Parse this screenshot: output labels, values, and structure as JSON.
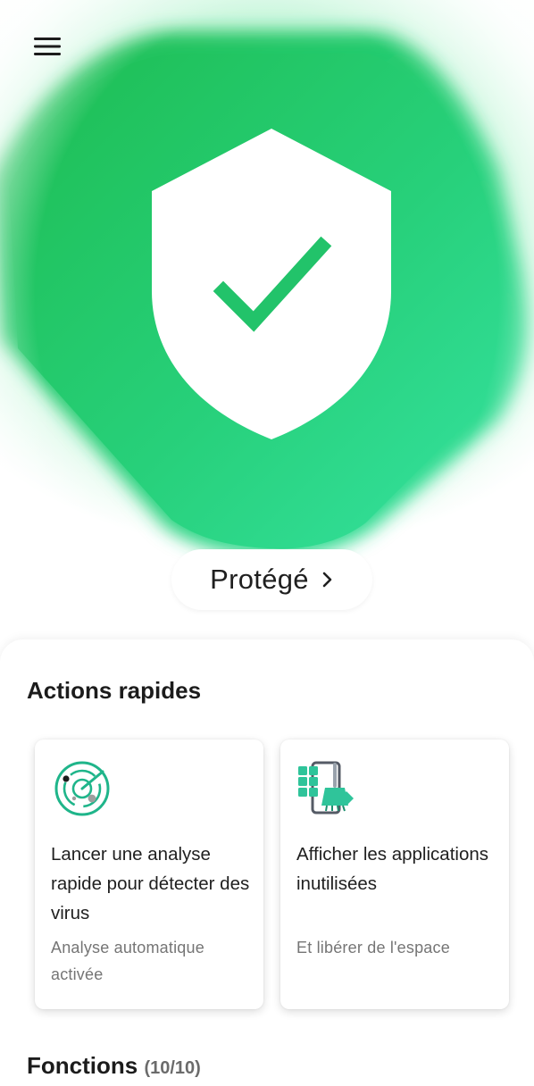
{
  "header": {
    "menu_icon": "hamburger-menu-icon"
  },
  "hero": {
    "shield_icon": "shield-check-icon",
    "status_label": "Protégé",
    "status_chevron_icon": "chevron-right-icon",
    "accent_color": "#22c55e"
  },
  "quick_actions": {
    "title": "Actions rapides",
    "cards": [
      {
        "icon": "radar-scan-icon",
        "title": "Lancer une analyse rapide pour détecter des virus",
        "subtitle": "Analyse automatique activée"
      },
      {
        "icon": "app-cleaner-icon",
        "title": "Afficher les applications inutilisées",
        "subtitle": "Et libérer de l'espace"
      }
    ]
  },
  "features": {
    "title": "Fonctions",
    "count": "(10/10)"
  }
}
